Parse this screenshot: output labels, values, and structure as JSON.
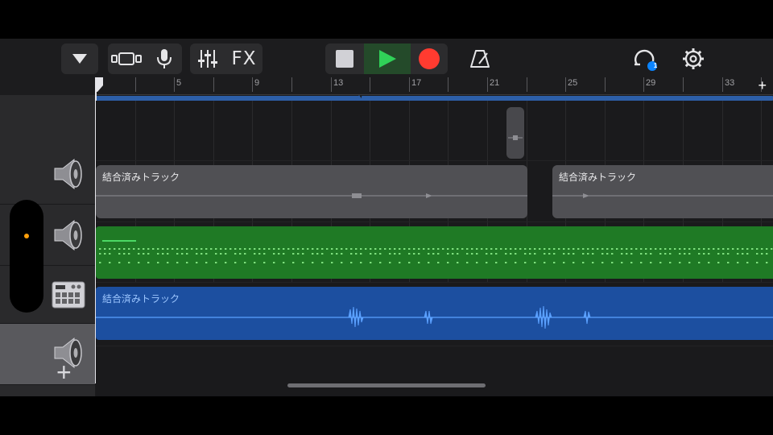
{
  "toolbar": {
    "fx_label": "FX",
    "loop_badge": "1",
    "icons": [
      "chevron-down-icon",
      "tracks-view-icon",
      "microphone-icon",
      "mixer-sliders-icon",
      "stop-icon",
      "play-icon",
      "record-icon",
      "metronome-icon",
      "loop-icon",
      "gear-icon"
    ],
    "colors": {
      "play": "#30d158",
      "record": "#ff3b30",
      "badge": "#0a84ff"
    }
  },
  "ruler": {
    "bars": [
      "5",
      "9",
      "13",
      "17",
      "21",
      "25",
      "29",
      "33"
    ],
    "add_label": "+"
  },
  "tracks": [
    {
      "icon": "speaker-icon",
      "selected": false
    },
    {
      "icon": "speaker-icon",
      "selected": false
    },
    {
      "icon": "drum-machine-icon",
      "selected": false
    },
    {
      "icon": "speaker-icon",
      "selected": true
    }
  ],
  "regions": {
    "track2_a_label": "結合済みトラック",
    "track2_b_label": "結合済みトラック",
    "track4_label": "結合済みトラック"
  },
  "add_track_label": "+",
  "colors": {
    "gray_region": "#505054",
    "green_region": "#1f7a25",
    "blue_region": "#1c4fa0",
    "loop_bar": "#2d5fa8"
  }
}
